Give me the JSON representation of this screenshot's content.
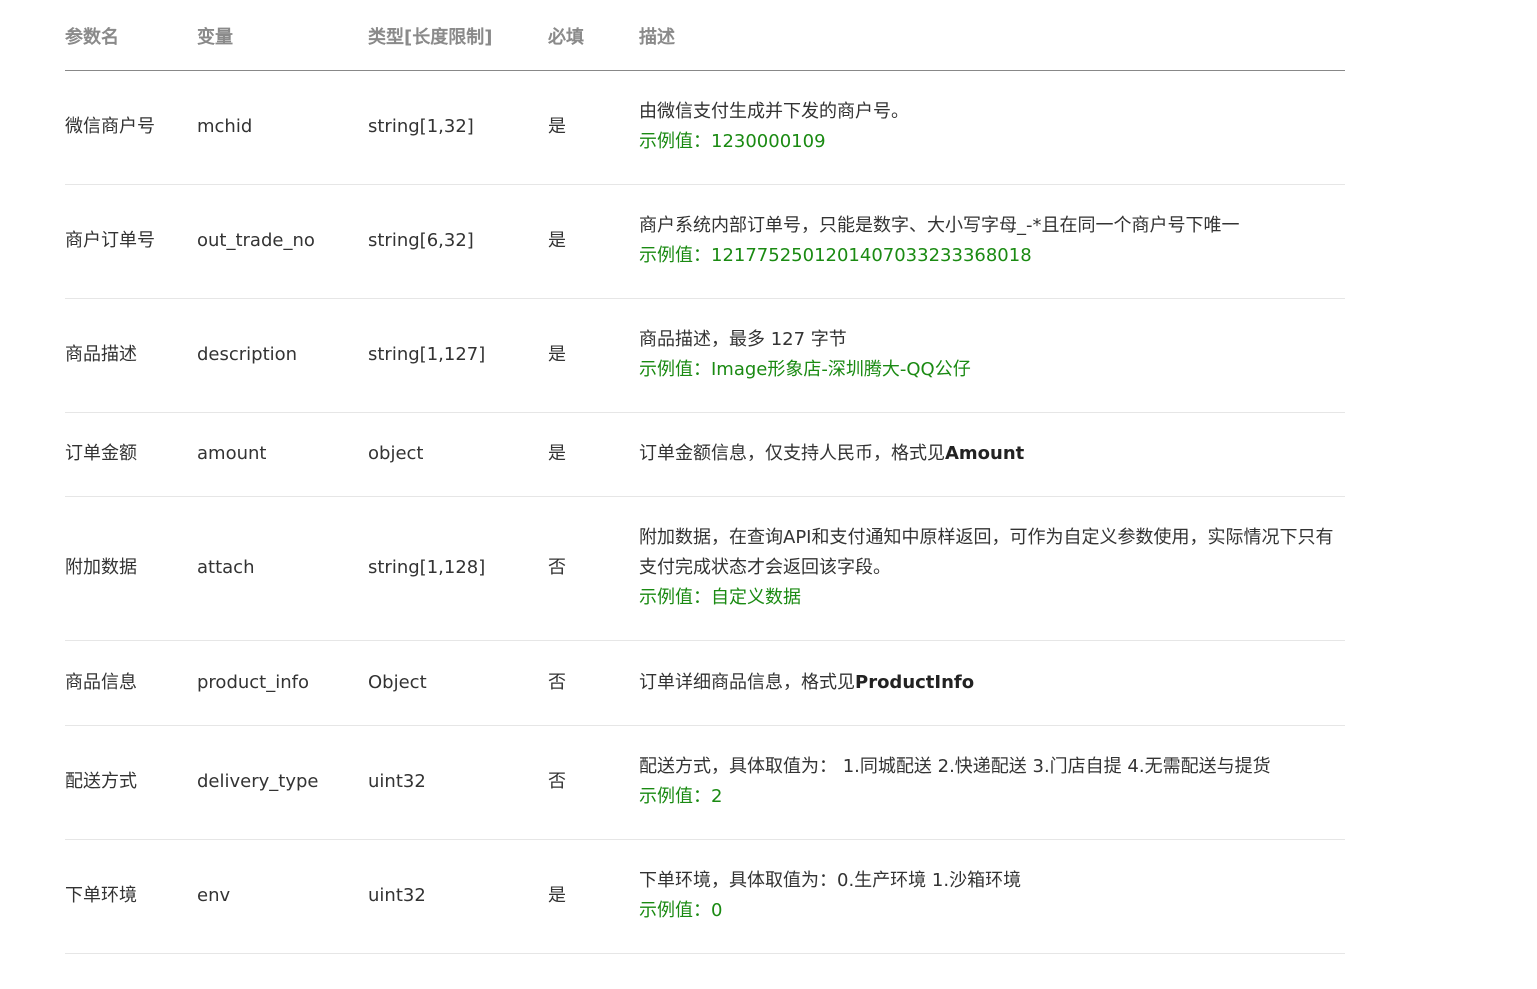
{
  "headers": {
    "param": "参数名",
    "variable": "变量",
    "type": "类型[长度限制]",
    "required": "必填",
    "desc": "描述"
  },
  "rows": [
    {
      "param": "微信商户号",
      "variable": "mchid",
      "type": "string[1,32]",
      "required": "是",
      "desc": "由微信支付生成并下发的商户号。",
      "example": "示例值：1230000109"
    },
    {
      "param": "商户订单号",
      "variable": "out_trade_no",
      "type": "string[6,32]",
      "required": "是",
      "desc": "商户系统内部订单号，只能是数字、大小写字母_-*且在同一个商户号下唯一",
      "example": "示例值：1217752501201407033233368018"
    },
    {
      "param": "商品描述",
      "variable": "description",
      "type": "string[1,127]",
      "required": "是",
      "desc": "商品描述，最多 127 字节",
      "example": "示例值：Image形象店-深圳腾大-QQ公仔"
    },
    {
      "param": "订单金额",
      "variable": "amount",
      "type": "object",
      "required": "是",
      "desc_prefix": "订单金额信息，仅支持人民币，格式见",
      "desc_strong": "Amount"
    },
    {
      "param": "附加数据",
      "variable": "attach",
      "type": "string[1,128]",
      "required": "否",
      "desc": "附加数据，在查询API和支付通知中原样返回，可作为自定义参数使用，实际情况下只有支付完成状态才会返回该字段。",
      "example": "示例值：自定义数据"
    },
    {
      "param": "商品信息",
      "variable": "product_info",
      "type": "Object",
      "required": "否",
      "desc_prefix": "订单详细商品信息，格式见",
      "desc_strong": "ProductInfo"
    },
    {
      "param": "配送方式",
      "variable": "delivery_type",
      "type": "uint32",
      "required": "否",
      "desc": "配送方式，具体取值为： 1.同城配送 2.快递配送 3.门店自提 4.无需配送与提货",
      "example": "示例值：2"
    },
    {
      "param": "下单环境",
      "variable": "env",
      "type": "uint32",
      "required": "是",
      "desc": "下单环境，具体取值为：0.生产环境 1.沙箱环境",
      "example": "示例值：0"
    }
  ],
  "colors": {
    "header_text": "#8a8a8a",
    "body_text": "#333333",
    "example_text": "#1a8a12",
    "header_rule": "#888888",
    "row_rule": "#e6e6e6"
  }
}
